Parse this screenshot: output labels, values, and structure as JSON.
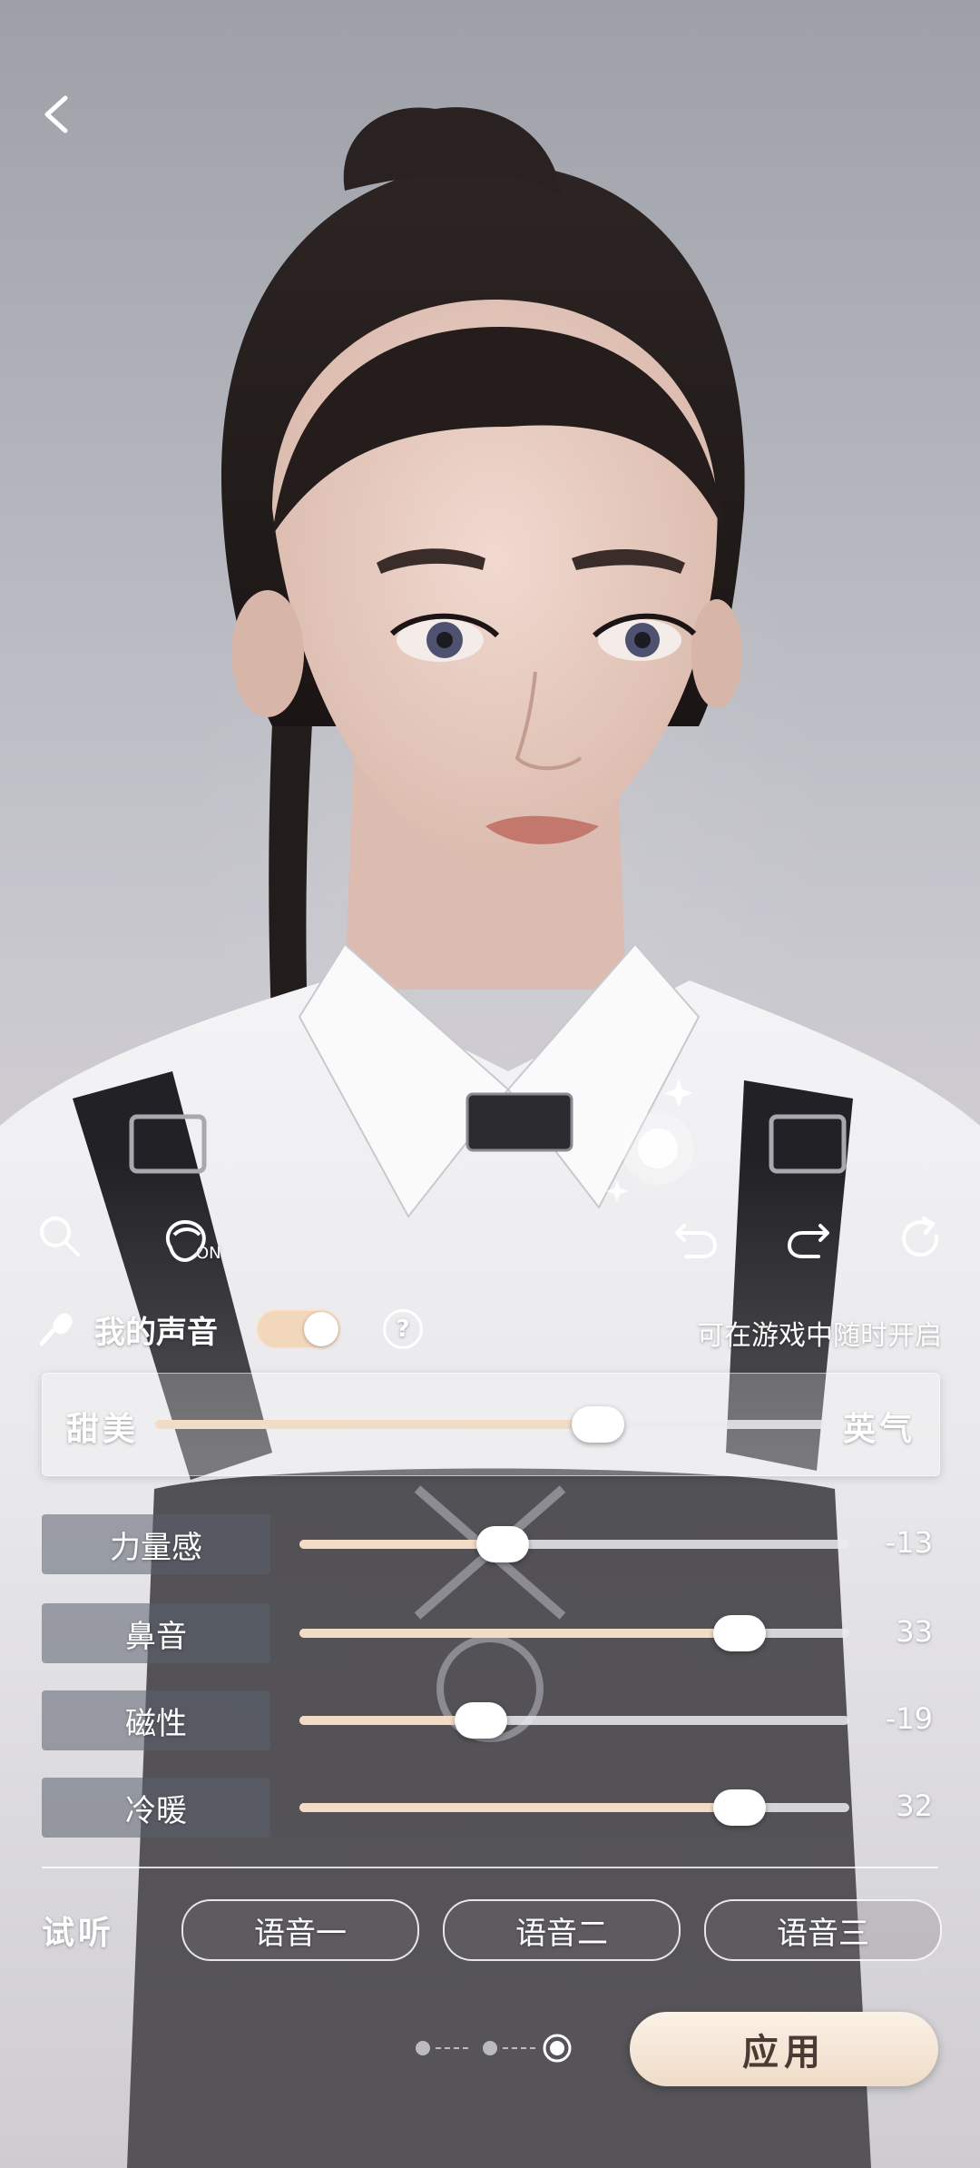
{
  "colors": {
    "accent_fill": "#f3dcc6",
    "apply_bg": "#f5e6d6",
    "apply_text": "#4b3b34"
  },
  "nav": {
    "back_icon": "chevron-left-icon"
  },
  "toolbar": {
    "search_icon": "search-icon",
    "hair_toggle_icon": "hair-toggle-icon",
    "hair_toggle_state": "ON",
    "undo_icon": "undo-icon",
    "redo_icon": "redo-icon",
    "reset_icon": "reset-icon"
  },
  "voice": {
    "mic_icon": "microphone-icon",
    "title": "我的声音",
    "toggle_on": true,
    "help_icon": "question-icon",
    "help_glyph": "?",
    "hint": "可在游戏中随时开启"
  },
  "main_slider": {
    "left_label": "甜美",
    "right_label": "英气",
    "value_fraction": 0.66
  },
  "sliders": [
    {
      "label": "力量感",
      "value": "-13",
      "fraction": 0.37
    },
    {
      "label": "鼻音",
      "value": "33",
      "fraction": 0.8
    },
    {
      "label": "磁性",
      "value": "-19",
      "fraction": 0.33
    },
    {
      "label": "冷暖",
      "value": "32",
      "fraction": 0.8
    }
  ],
  "preview": {
    "label": "试听",
    "options": [
      "语音一",
      "语音二",
      "语音三"
    ]
  },
  "pager": {
    "count": 3,
    "active": 3
  },
  "apply_label": "应用"
}
